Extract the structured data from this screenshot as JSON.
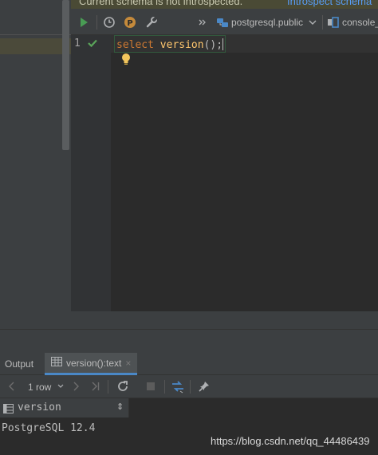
{
  "banner": {
    "message": "Current schema is not introspected.",
    "link": "Introspect schema"
  },
  "toolbar": {
    "schema": "postgresql.public",
    "console": "console_"
  },
  "editor": {
    "line_number": "1",
    "code": {
      "keyword": "select",
      "function": "version",
      "rest": "();"
    }
  },
  "output": {
    "tab_output": "Output",
    "tab_result": "version():text",
    "tab_close": "×",
    "rows": "1 row"
  },
  "grid": {
    "column": "version",
    "sort_glyph": "⇕",
    "value": "PostgreSQL 12.4"
  },
  "watermark": "https://blog.csdn.net/qq_44486439",
  "colors": {
    "run": "#499c54",
    "keyword": "#cc7832",
    "function": "#ffc66d",
    "link": "#589df6",
    "bulb": "#f2c55c",
    "tab_underline": "#4a88c7",
    "db_icon": "#4a88c7"
  },
  "icons": {
    "run": "play-icon",
    "history": "clock-icon",
    "profile": "p-badge-icon",
    "settings": "wrench-icon",
    "more": "double-chevron-right-icon",
    "datasource": "database-icon",
    "dropdown": "chevron-down-icon",
    "console": "console-icon",
    "check": "check-icon",
    "intention": "bulb-icon",
    "table": "table-icon",
    "prev": "chevron-left-icon",
    "next": "chevron-right-icon",
    "last": "last-page-icon",
    "reload": "reload-icon",
    "stop": "stop-icon",
    "compare": "compare-icon",
    "pin": "pin-icon",
    "column": "column-icon"
  }
}
